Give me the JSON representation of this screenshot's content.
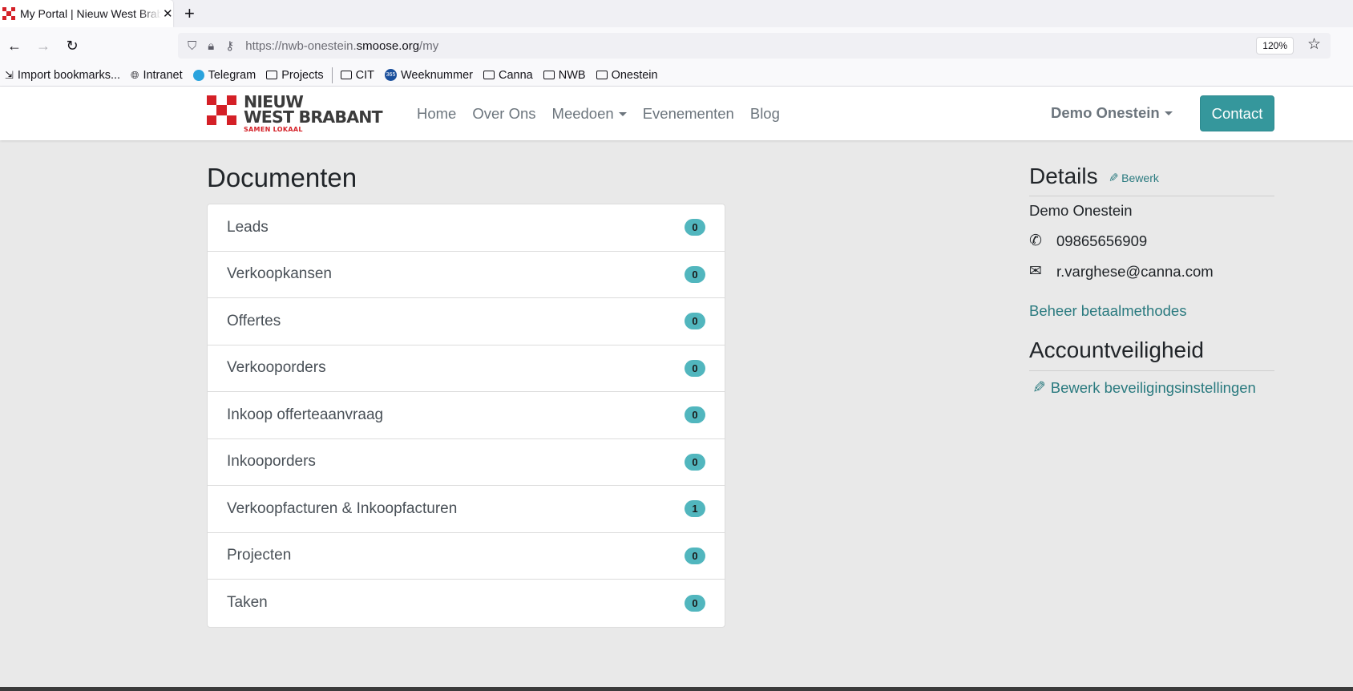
{
  "browser": {
    "tab_title": "My Portal | Nieuw West Brabant",
    "url_prefix": "https://nwb-onestein.",
    "url_domain": "smoose.org",
    "url_path": "/my",
    "zoom": "120%",
    "bookmarks": [
      {
        "label": "Import bookmarks...",
        "icon": "import-icon"
      },
      {
        "label": "Intranet",
        "icon": "globe-icon"
      },
      {
        "label": "Telegram",
        "icon": "telegram-icon"
      },
      {
        "label": "Projects",
        "icon": "folder-icon"
      },
      {
        "label": "CIT",
        "icon": "folder-icon"
      },
      {
        "label": "Weeknummer",
        "icon": "weeknummer-icon"
      },
      {
        "label": "Canna",
        "icon": "folder-icon"
      },
      {
        "label": "NWB",
        "icon": "folder-icon"
      },
      {
        "label": "Onestein",
        "icon": "folder-icon"
      }
    ]
  },
  "site": {
    "logo_line1": "NIEUW",
    "logo_line2": "WEST BRABANT",
    "logo_sub": "SAMEN LOKAAL",
    "nav": [
      "Home",
      "Over Ons",
      "Meedoen",
      "Evenementen",
      "Blog"
    ],
    "user": "Demo Onestein",
    "contact": "Contact",
    "colors": {
      "accent": "#35979c",
      "link": "#2a7a7f",
      "badge": "#51b6be",
      "logo_red": "#d42027"
    }
  },
  "documents": {
    "title": "Documenten",
    "items": [
      {
        "label": "Leads",
        "count": "0"
      },
      {
        "label": "Verkoopkansen",
        "count": "0"
      },
      {
        "label": "Offertes",
        "count": "0"
      },
      {
        "label": "Verkooporders",
        "count": "0"
      },
      {
        "label": "Inkoop offerteaanvraag",
        "count": "0"
      },
      {
        "label": "Inkooporders",
        "count": "0"
      },
      {
        "label": "Verkoopfacturen & Inkoopfacturen",
        "count": "1"
      },
      {
        "label": "Projecten",
        "count": "0"
      },
      {
        "label": "Taken",
        "count": "0"
      }
    ]
  },
  "details": {
    "title": "Details",
    "edit": "Bewerk",
    "name": "Demo Onestein",
    "phone": "09865656909",
    "email": "r.varghese@canna.com",
    "payment_link": "Beheer betaalmethodes",
    "security_title": "Accountveiligheid",
    "security_link": "Bewerk beveiligingsinstellingen"
  }
}
